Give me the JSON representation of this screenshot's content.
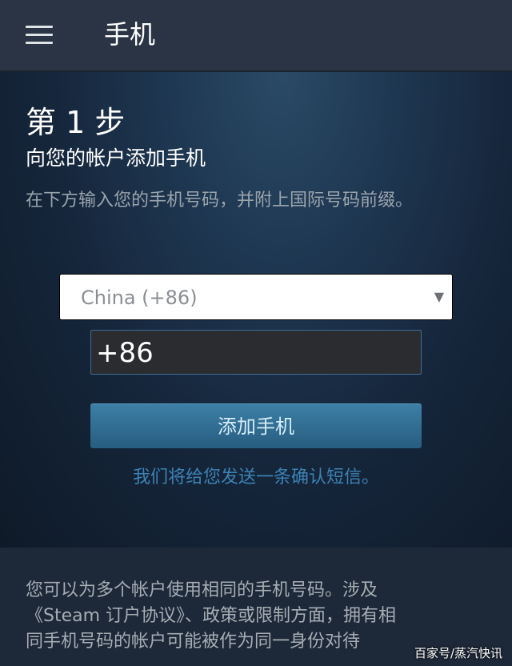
{
  "header": {
    "title": "手机"
  },
  "step": {
    "title": "第 1 步",
    "subtitle": "向您的帐户添加手机",
    "description": "在下方输入您的手机号码，并附上国际号码前缀。"
  },
  "form": {
    "country_selected": "China (+86)",
    "phone_value": "+86",
    "submit_label": "添加手机",
    "note": "我们将给您发送一条确认短信。"
  },
  "footer": {
    "lines": [
      "您可以为多个帐户使用相同的手机号码。涉及",
      "《Steam 订户协议》、政策或限制方面，拥有相",
      "同手机号码的帐户可能被作为同一身份对待"
    ]
  },
  "watermark": "百家号/蒸汽快讯",
  "icons": {
    "menu": "hamburger-menu-icon",
    "dropdown": "caret-down-icon"
  },
  "colors": {
    "accent": "#3c82b4",
    "button": "#2f6b92",
    "topbar": "#2a3444"
  }
}
